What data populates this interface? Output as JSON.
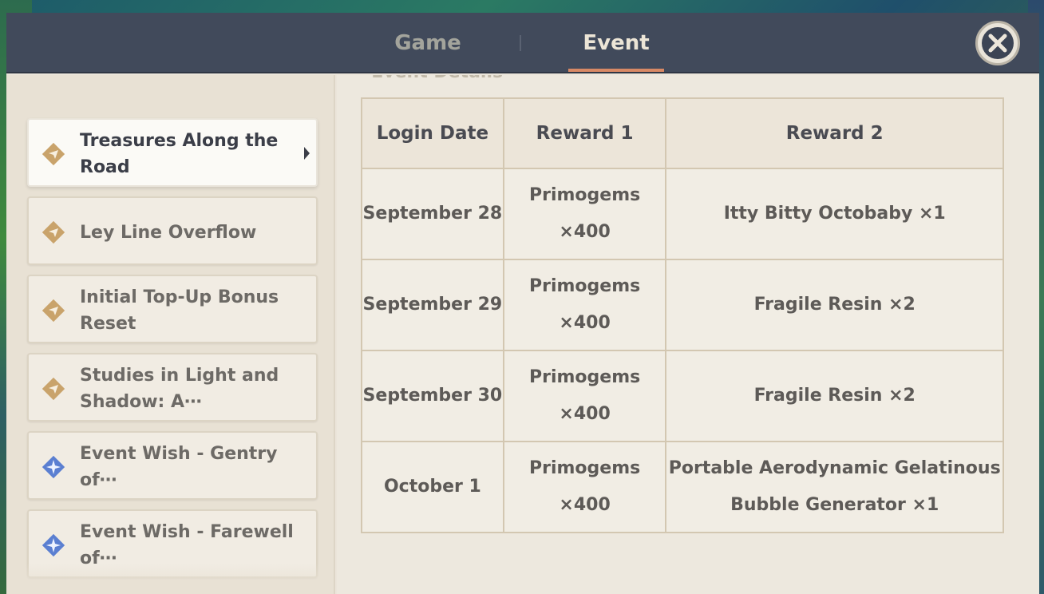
{
  "header": {
    "tabs": [
      {
        "label": "Game",
        "active": false
      },
      {
        "label": "Event",
        "active": true
      }
    ],
    "close_icon": "close-x-icon"
  },
  "sidebar": {
    "items": [
      {
        "label": "Treasures Along the Road",
        "icon": "paper-plane-diamond-icon",
        "active": true
      },
      {
        "label": "Ley Line Overflow",
        "icon": "paper-plane-diamond-icon",
        "active": false
      },
      {
        "label": "Initial Top-Up Bonus Reset",
        "icon": "paper-plane-diamond-icon",
        "active": false
      },
      {
        "label": "Studies in Light and Shadow: A⋯",
        "icon": "paper-plane-diamond-icon",
        "active": false
      },
      {
        "label": "Event Wish - Gentry of⋯",
        "icon": "wish-star-icon",
        "active": false
      },
      {
        "label": "Event Wish - Farewell of⋯",
        "icon": "wish-star-icon",
        "active": false
      }
    ]
  },
  "main": {
    "section_title": "═Event Details═",
    "table": {
      "headers": [
        "Login Date",
        "Reward 1",
        "Reward 2"
      ],
      "rows": [
        {
          "date": "September 28",
          "reward1": "Primogems ×400",
          "reward2": "Itty Bitty Octobaby ×1"
        },
        {
          "date": "September 29",
          "reward1": "Primogems ×400",
          "reward2": "Fragile Resin ×2"
        },
        {
          "date": "September 30",
          "reward1": "Primogems ×400",
          "reward2": "Fragile Resin ×2"
        },
        {
          "date": "October 1",
          "reward1": "Primogems ×400",
          "reward2": "Portable Aerodynamic Gelatinous Bubble Generator ×1"
        }
      ]
    }
  },
  "colors": {
    "header_bg": "#414a5b",
    "accent_underline": "#d88965",
    "gold_icon": "#c9a36b",
    "wish_icon": "#5b7fd1"
  }
}
